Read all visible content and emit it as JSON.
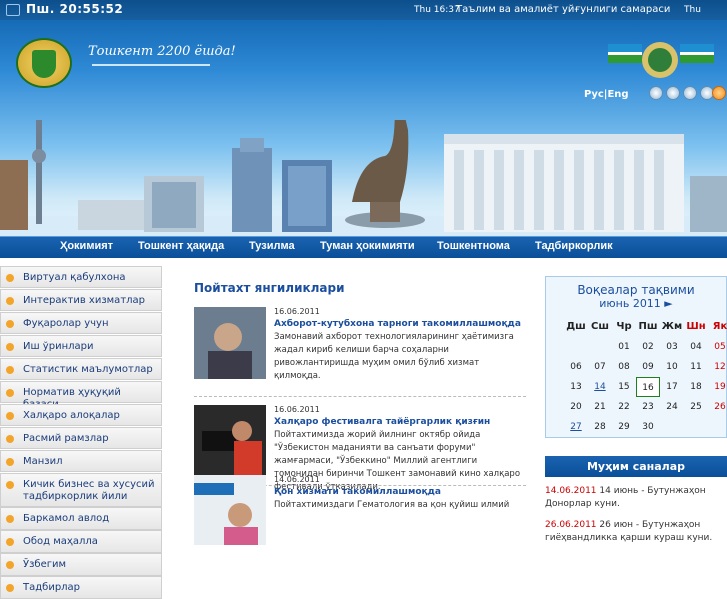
{
  "topbar": {
    "clock": "Пш. 20:55:52",
    "ticker_time": "Thu 16:37",
    "ticker_text": "Таълим ва амалиёт уйғунлиги самараси",
    "ticker_time2": "Thu"
  },
  "header": {
    "slogan": "Тошкент 2200 ёшда!",
    "lang_ru": "Рус",
    "lang_sep": "|",
    "lang_en": "Eng"
  },
  "nav": [
    "Ҳокимият",
    "Тошкент ҳақида",
    "Тузилма",
    "Туман ҳокимияти",
    "Тошкентнома",
    "Тадбиркорлик"
  ],
  "sidebar": [
    "Виртуал қабулхона",
    "Интерактив хизматлар",
    "Фуқаролар учун",
    "Иш ўринлари",
    "Статистик маълумотлар",
    "Норматив ҳуқуқий базаси",
    "Халқаро алоқалар",
    "Расмий рамзлар",
    "Манзил",
    "Кичик бизнес ва хусусий тадбиркорлик йили",
    "Баркамол авлод",
    "Обод маҳалла",
    "Ўзбегим",
    "Тадбирлар"
  ],
  "news_title": "Пойтахт янгиликлари",
  "news": [
    {
      "date": "16.06.2011",
      "headline": "Ахборот-кутубхона тарноги такомиллашмоқда",
      "body": "Замонавий ахборот технологияларининг ҳаётимизга жадал кириб келиши барча соҳаларни ривожлантиришда муҳим омил бўлиб хизмат қилмоқда."
    },
    {
      "date": "16.06.2011",
      "headline": "Халқаро фестивалга тайёргарлик қизғин",
      "body": "Пойтахтимизда жорий йилнинг октябр ойида \"Ўзбекистон маданияти ва санъати форуми\" жамғармаси, \"Ўзбеккино\" Миллий агентлиги томонидан биринчи Тошкент замонавий кино халқаро фестивали ўтказилади."
    },
    {
      "date": "14.06.2011",
      "headline": "Қон хизмати такомиллашмоқда",
      "body": "Пойтахтимиздаги Гематология ва қон қуйиш илмий"
    }
  ],
  "calendar": {
    "title": "Воқеалар тақвими",
    "month": "июнь 2011 ►",
    "weekdays": [
      "Дш",
      "Сш",
      "Чр",
      "Пш",
      "Жм",
      "Шн",
      "Як"
    ],
    "weeks": [
      [
        "",
        "",
        "01",
        "02",
        "03",
        "04",
        "05"
      ],
      [
        "06",
        "07",
        "08",
        "09",
        "10",
        "11",
        "12"
      ],
      [
        "13",
        "14",
        "15",
        "16",
        "17",
        "18",
        "19"
      ],
      [
        "20",
        "21",
        "22",
        "23",
        "24",
        "25",
        "26"
      ],
      [
        "27",
        "28",
        "29",
        "30",
        "",
        "",
        ""
      ]
    ],
    "today": "16"
  },
  "events": {
    "title": "Муҳим саналар",
    "items": [
      {
        "date": "14.06.2011",
        "text": "14 июнь - Бутунжаҳон Донорлар куни."
      },
      {
        "date": "26.06.2011",
        "text": "26 июн - Бутунжаҳон гиёҳвандликка қарши кураш куни."
      }
    ]
  },
  "colors": {
    "accent": "#1b4f9e",
    "nav": "#0a4f98",
    "weekend": "#c00000",
    "bullet": "#f3a52b"
  }
}
